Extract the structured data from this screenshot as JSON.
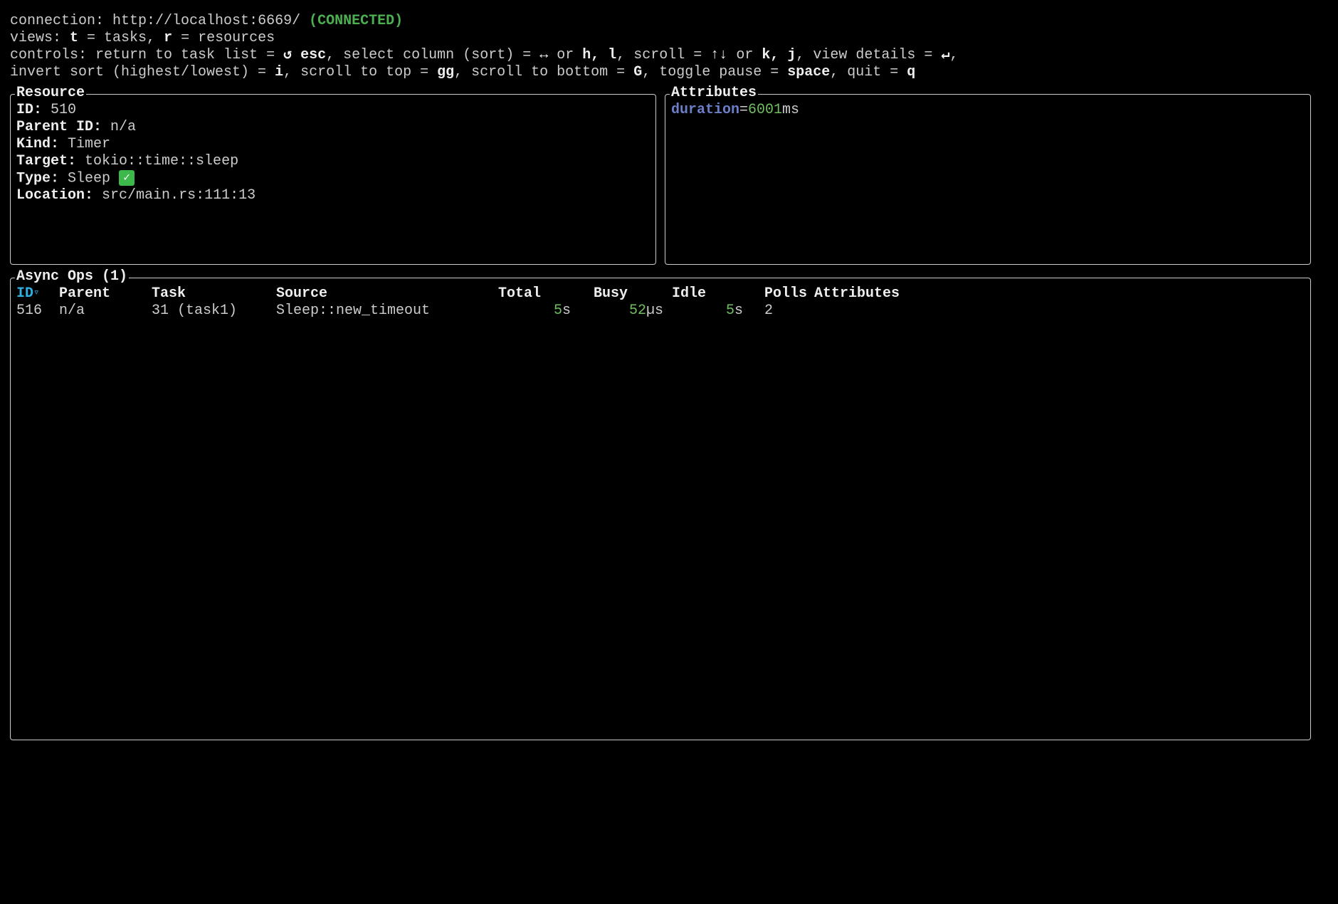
{
  "header": {
    "connection_label": "connection: ",
    "connection_url": "http://localhost:6669/",
    "connection_status": "(CONNECTED)",
    "views_label": "views: ",
    "views_t_key": "t",
    "views_t_desc": " = tasks, ",
    "views_r_key": "r",
    "views_r_desc": " = resources",
    "controls_label": "controls: ",
    "controls_return": "return to task list = ",
    "controls_return_icon": "↺",
    "controls_esc": "esc",
    "controls_sort": ", select column (sort) = ",
    "controls_sort_icon": "↔",
    "controls_or1": " or ",
    "controls_hl": "h, l",
    "controls_scroll": ", scroll = ",
    "controls_scroll_icon": "↑↓",
    "controls_or2": " or ",
    "controls_kj": "k, j",
    "controls_view": ", view details = ",
    "controls_enter_icon": "↵",
    "controls_comma": ",",
    "controls_invert": "invert sort (highest/lowest) = ",
    "controls_i": "i",
    "controls_top": ", scroll to top = ",
    "controls_gg": "gg",
    "controls_bottom": ", scroll to bottom = ",
    "controls_G": "G",
    "controls_pause": ", toggle pause = ",
    "controls_space": "space",
    "controls_quit": ", quit = ",
    "controls_q": "q"
  },
  "resource": {
    "title": "Resource",
    "id_label": "ID:",
    "id_value": "510",
    "parent_label": "Parent ID:",
    "parent_value": "n/a",
    "kind_label": "Kind:",
    "kind_value": "Timer",
    "target_label": "Target:",
    "target_value": "tokio::time::sleep",
    "type_label": "Type:",
    "type_value": "Sleep",
    "location_label": "Location:",
    "location_value": "src/main.rs:111:13"
  },
  "attributes": {
    "title": "Attributes",
    "key": "duration",
    "eq": "=",
    "value": "6001",
    "unit": "ms"
  },
  "async_ops": {
    "title": "Async Ops (1)",
    "columns": {
      "id": "ID",
      "sort_arrow": "▿",
      "parent": "Parent",
      "task": "Task",
      "source": "Source",
      "total": "Total",
      "busy": "Busy",
      "idle": "Idle",
      "polls": "Polls",
      "attributes": "Attributes"
    },
    "rows": [
      {
        "id": "516",
        "parent": "n/a",
        "task": "31 (task1)",
        "source": "Sleep::new_timeout",
        "total_num": "5",
        "total_unit": "s",
        "busy_num": "52",
        "busy_unit": "µs",
        "idle_num": "5",
        "idle_unit": "s",
        "polls": "2",
        "attributes": ""
      }
    ]
  }
}
